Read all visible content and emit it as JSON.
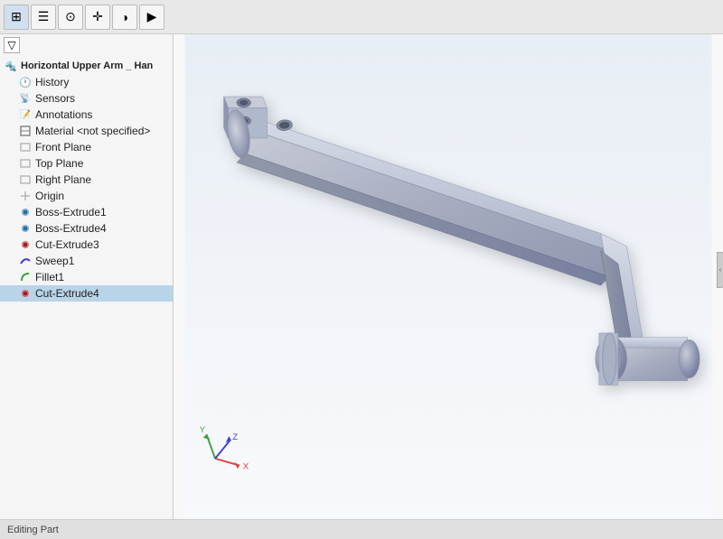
{
  "toolbar": {
    "buttons": [
      {
        "name": "feature-manager-icon",
        "symbol": "⊞",
        "tooltip": "Feature Manager"
      },
      {
        "name": "property-manager-icon",
        "symbol": "☰",
        "tooltip": "Property Manager"
      },
      {
        "name": "configuration-icon",
        "symbol": "⊙",
        "tooltip": "Configuration"
      },
      {
        "name": "dim-expert-icon",
        "symbol": "✛",
        "tooltip": "DimXpert"
      },
      {
        "name": "display-icon",
        "symbol": "◑",
        "tooltip": "Display"
      },
      {
        "name": "more-icon",
        "symbol": "▶",
        "tooltip": "More"
      }
    ]
  },
  "feature_tree": {
    "title": "Horizontal Upper Arm _ Han",
    "items": [
      {
        "id": "history",
        "label": "History",
        "indent": 1,
        "icon": "clock",
        "selected": false
      },
      {
        "id": "sensors",
        "label": "Sensors",
        "indent": 1,
        "icon": "sensor",
        "selected": false
      },
      {
        "id": "annotations",
        "label": "Annotations",
        "indent": 1,
        "icon": "annotation",
        "selected": false
      },
      {
        "id": "material",
        "label": "Material <not specified>",
        "indent": 1,
        "icon": "material",
        "selected": false
      },
      {
        "id": "front-plane",
        "label": "Front Plane",
        "indent": 1,
        "icon": "plane",
        "selected": false
      },
      {
        "id": "top-plane",
        "label": "Top Plane",
        "indent": 1,
        "icon": "plane",
        "selected": false
      },
      {
        "id": "right-plane",
        "label": "Right Plane",
        "indent": 1,
        "icon": "plane",
        "selected": false
      },
      {
        "id": "origin",
        "label": "Origin",
        "indent": 1,
        "icon": "origin",
        "selected": false
      },
      {
        "id": "boss-extrude1",
        "label": "Boss-Extrude1",
        "indent": 1,
        "icon": "boss",
        "selected": false
      },
      {
        "id": "boss-extrude4",
        "label": "Boss-Extrude4",
        "indent": 1,
        "icon": "boss",
        "selected": false
      },
      {
        "id": "cut-extrude3",
        "label": "Cut-Extrude3",
        "indent": 1,
        "icon": "cut",
        "selected": false
      },
      {
        "id": "sweep1",
        "label": "Sweep1",
        "indent": 1,
        "icon": "sweep",
        "selected": false
      },
      {
        "id": "fillet1",
        "label": "Fillet1",
        "indent": 1,
        "icon": "fillet",
        "selected": false
      },
      {
        "id": "cut-extrude4",
        "label": "Cut-Extrude4",
        "indent": 1,
        "icon": "cut",
        "selected": true
      }
    ]
  },
  "status_bar": {
    "text": "Editing Part"
  },
  "viewport": {
    "background": "#f8f8f8"
  }
}
